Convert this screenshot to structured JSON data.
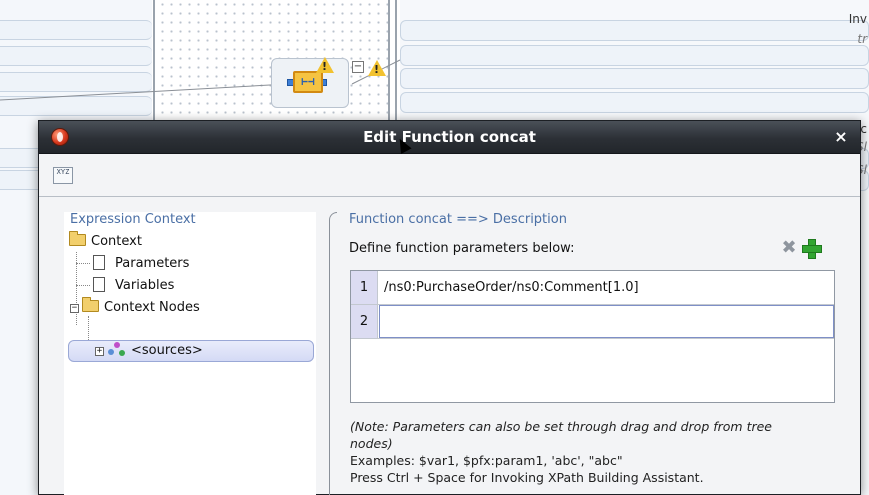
{
  "background": {
    "right_labels": [
      {
        "text": "Inv",
        "italic": false
      },
      {
        "text": "tr",
        "italic": true
      },
      {
        "text": "ec",
        "italic": false
      },
      {
        "text": "Sl",
        "italic": true
      },
      {
        "text": "Sl",
        "italic": true
      }
    ],
    "function_node_icon": "function-concat-icon",
    "warning_icon": "warning-triangle-icon",
    "warning_glyph": "!",
    "collapse_glyph": "−"
  },
  "dialog": {
    "title": "Edit Function concat",
    "close_glyph": "×",
    "toolbar_icon": "xpath-building-assistant-icon",
    "toolbar_icon_text": "XYZ"
  },
  "expression_context": {
    "heading": "Expression Context",
    "tree": {
      "root": "Context",
      "children": [
        "Parameters",
        "Variables",
        "Context Nodes"
      ],
      "context_nodes_children": [
        "<sources>"
      ],
      "expander_expanded": "−",
      "expander_collapsed": "+"
    }
  },
  "function": {
    "heading": "Function concat ==> Description",
    "define_label": "Define function parameters below:",
    "delete_glyph": "✖",
    "parameters": [
      {
        "index": "1",
        "value": "/ns0:PurchaseOrder/ns0:Comment[1.0]"
      },
      {
        "index": "2",
        "value": ""
      }
    ],
    "note_line1": "(Note: Parameters can also be set through drag and drop from tree",
    "note_line2": "nodes)",
    "examples": "Examples: $var1, $pfx:param1, 'abc', \"abc\"",
    "hint": "Press Ctrl + Space for Invoking XPath Building Assistant."
  },
  "colors": {
    "titlebar": "#2c3036",
    "heading_blue": "#4a6fa5",
    "add_green": "#33a532",
    "selection": "#d4daf5"
  }
}
